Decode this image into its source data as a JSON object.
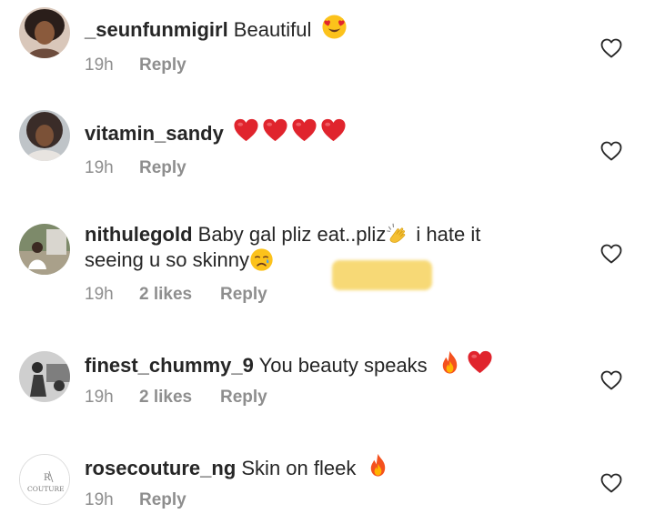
{
  "comments": [
    {
      "username": "_seunfunmigirl",
      "text": " Beautiful",
      "emojis": [
        "heart-eyes"
      ],
      "time": "19h",
      "likes": "",
      "reply": "Reply"
    },
    {
      "username": "vitamin_sandy",
      "text": "",
      "emojis": [
        "red-heart",
        "red-heart",
        "red-heart",
        "red-heart"
      ],
      "time": "19h",
      "likes": "",
      "reply": "Reply"
    },
    {
      "username": "nithulegold",
      "text_part1": " Baby gal pliz eat..pliz",
      "text_part2": " i hate it",
      "text_line2": "seeing u so skinny",
      "emojis": [
        "clapping-hands",
        "crying-face"
      ],
      "time": "19h",
      "likes": "2 likes",
      "reply": "Reply"
    },
    {
      "username": "finest_chummy_9",
      "text": " You beauty speaks",
      "emojis": [
        "fire",
        "red-heart"
      ],
      "time": "19h",
      "likes": "2 likes",
      "reply": "Reply"
    },
    {
      "username": "rosecouture_ng",
      "text": " Skin on fleek",
      "emojis": [
        "fire"
      ],
      "time": "19h",
      "likes": "",
      "reply": "Reply",
      "avatar_text_1": "R",
      "avatar_text_2": "COUTURE"
    }
  ],
  "colors": {
    "text": "#262626",
    "meta": "#8e8e8e",
    "highlight": "#f6d35f"
  }
}
